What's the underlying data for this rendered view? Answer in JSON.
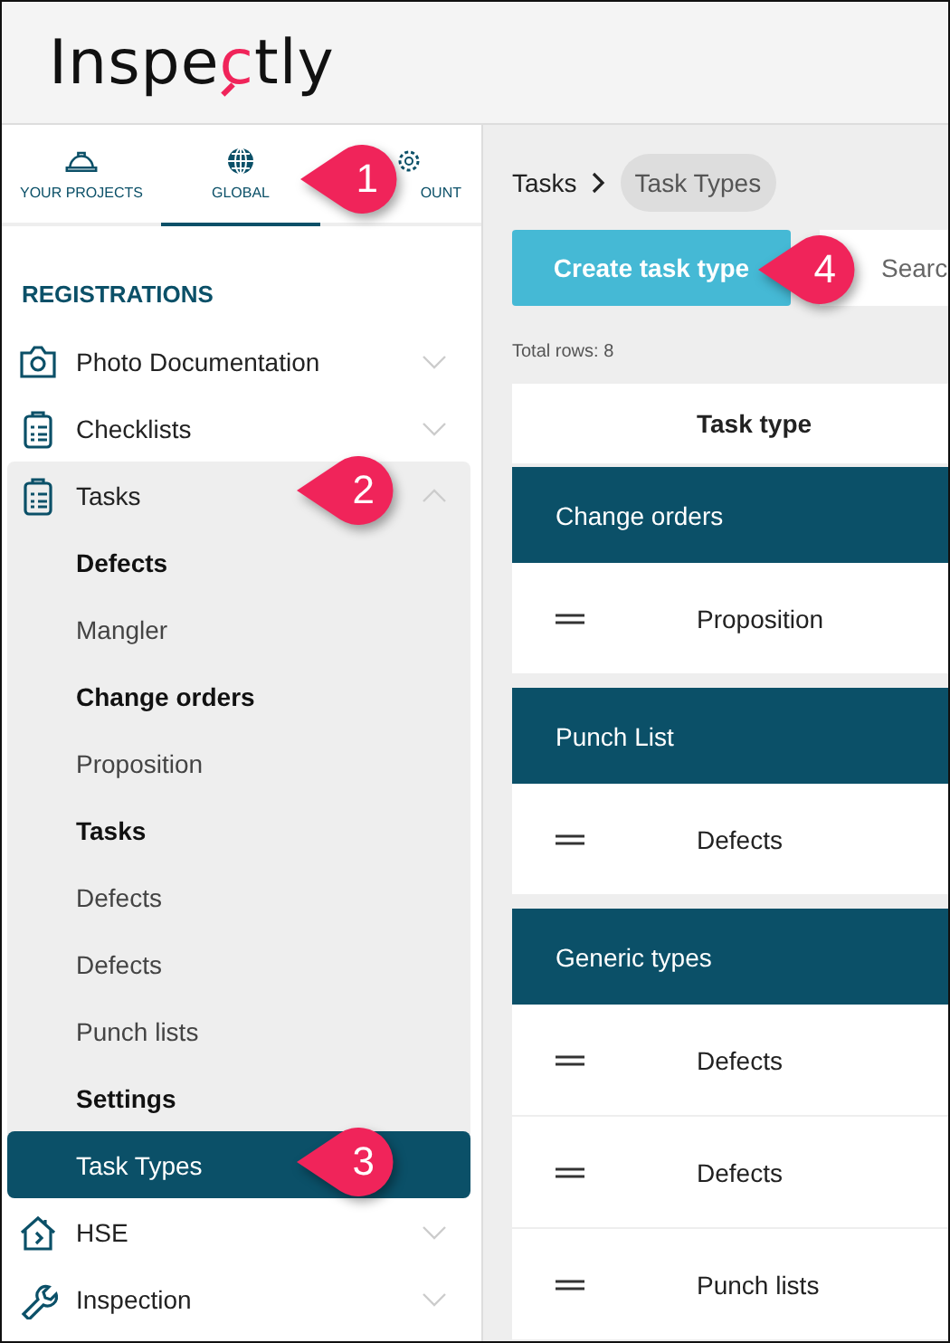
{
  "logo": {
    "before": "Inspe",
    "accent": "c",
    "after": "tly"
  },
  "tabs": [
    {
      "label": "YOUR PROJECTS",
      "selected": false
    },
    {
      "label": "GLOBAL",
      "selected": true
    },
    {
      "label": "OUNT",
      "selected": false
    }
  ],
  "sidebar": {
    "heading": "REGISTRATIONS",
    "items": [
      {
        "label": "Photo Documentation",
        "expanded": false
      },
      {
        "label": "Checklists",
        "expanded": false
      },
      {
        "label": "Tasks",
        "expanded": true,
        "children": [
          {
            "kind": "heading",
            "label": "Defects"
          },
          {
            "kind": "link",
            "label": "Mangler",
            "selected": false
          },
          {
            "kind": "heading",
            "label": "Change orders"
          },
          {
            "kind": "link",
            "label": "Proposition",
            "selected": false
          },
          {
            "kind": "heading",
            "label": "Tasks"
          },
          {
            "kind": "link",
            "label": "Defects",
            "selected": false
          },
          {
            "kind": "link",
            "label": "Defects",
            "selected": false
          },
          {
            "kind": "link",
            "label": "Punch lists",
            "selected": false
          },
          {
            "kind": "heading",
            "label": "Settings"
          },
          {
            "kind": "link",
            "label": "Task Types",
            "selected": true
          }
        ]
      },
      {
        "label": "HSE",
        "expanded": false
      },
      {
        "label": "Inspection",
        "expanded": false
      }
    ]
  },
  "breadcrumb": [
    "Tasks",
    "Task Types"
  ],
  "create_button": "Create task type",
  "search": {
    "placeholder": "Searc"
  },
  "total_rows": "Total rows: 8",
  "table": {
    "columns": [
      "Task type"
    ],
    "groups": [
      {
        "name": "Change orders",
        "rows": [
          "Proposition"
        ]
      },
      {
        "name": "Punch List",
        "rows": [
          "Defects"
        ]
      },
      {
        "name": "Generic types",
        "rows": [
          "Defects",
          "Defects",
          "Punch lists"
        ]
      }
    ]
  },
  "callouts": [
    "1",
    "2",
    "3",
    "4"
  ]
}
